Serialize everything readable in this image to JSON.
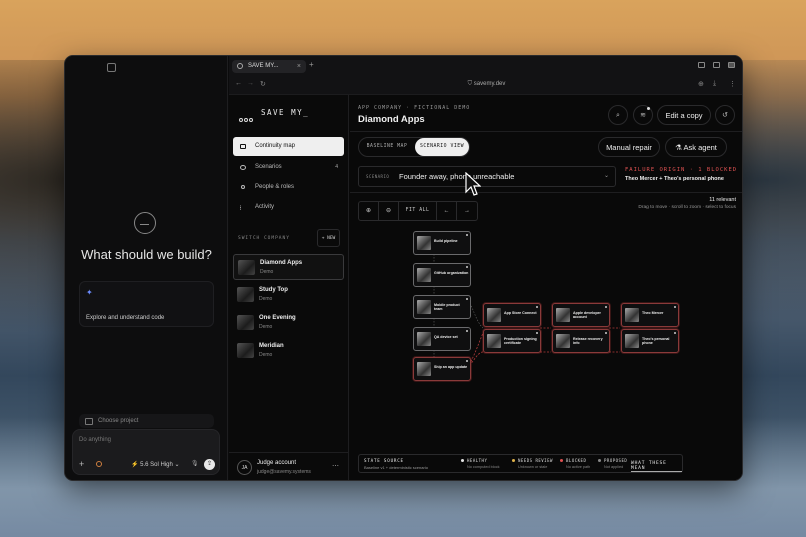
{
  "chat": {
    "title": "What should we build?",
    "card_label": "Explore and understand code",
    "choose_project": "Choose project",
    "composer_placeholder": "Do anything",
    "model": "5.6 Sol",
    "effort": "High"
  },
  "browser": {
    "tab_title": "SAVE MY...",
    "url": "savemy.dev"
  },
  "app": {
    "brand": "SAVE MY_",
    "nav": [
      {
        "label": "Continuity map",
        "icon": "map-icon"
      },
      {
        "label": "Scenarios",
        "icon": "bolt-icon",
        "badge": "4"
      },
      {
        "label": "People & roles",
        "icon": "person-icon"
      },
      {
        "label": "Activity",
        "icon": "list-icon"
      }
    ],
    "switch_company": "SWITCH COMPANY",
    "new_label": "+ NEW",
    "companies": [
      {
        "name": "Diamond Apps",
        "sub": "Demo"
      },
      {
        "name": "Study Top",
        "sub": "Demo"
      },
      {
        "name": "One Evening",
        "sub": "Demo"
      },
      {
        "name": "Meridian",
        "sub": "Demo"
      }
    ],
    "account": {
      "initials": "JA",
      "name": "Judge account",
      "email": "judge@savemy.systems"
    }
  },
  "main": {
    "eyebrow": "APP COMPANY · FICTIONAL DEMO",
    "title": "Diamond Apps",
    "edit_copy": "Edit a copy",
    "seg_baseline": "BASELINE MAP",
    "seg_scenario": "SCENARIO VIEW",
    "manual_repair": "Manual repair",
    "ask_agent": "Ask agent",
    "scenario_label": "SCENARIO",
    "scenario_value": "Founder away, phone unreachable",
    "failure_origin": "FAILURE ORIGIN · 1 BLOCKED",
    "failure_detail": "Theo Mercer + Theo's personal phone",
    "relevant": "11 relevant",
    "hint": "Drag to move · scroll to zoom · select to focus",
    "fit_all": "FIT ALL",
    "arrow_left": "←",
    "arrow_right": "→"
  },
  "nodes": [
    {
      "title": "Build pipeline",
      "status": "normal"
    },
    {
      "title": "GitHub organization",
      "status": "normal"
    },
    {
      "title": "Mobile product team",
      "status": "normal"
    },
    {
      "title": "QA device set",
      "status": "normal"
    },
    {
      "title": "Ship an app update",
      "status": "red"
    },
    {
      "title": "App Store Connect",
      "status": "red"
    },
    {
      "title": "Production signing certificate",
      "status": "red"
    },
    {
      "title": "Apple developer account",
      "status": "red"
    },
    {
      "title": "Release recovery info",
      "status": "red"
    },
    {
      "title": "Theo Mercer",
      "status": "red"
    },
    {
      "title": "Theo's personal phone",
      "status": "red"
    }
  ],
  "legend": {
    "title": "STATE SOURCE",
    "sub": "Baseline v1 + deterministic scenario",
    "items": [
      {
        "name": "HEALTHY",
        "desc": "No computed block",
        "color": "#e6e6e6"
      },
      {
        "name": "NEEDS REVIEW",
        "desc": "Unknown or stale",
        "color": "#e0b24a"
      },
      {
        "name": "BLOCKED",
        "desc": "No active path",
        "color": "#e05252"
      },
      {
        "name": "PROPOSED",
        "desc": "Not applied",
        "color": "#888888"
      }
    ],
    "link": "WHAT THESE MEAN"
  }
}
